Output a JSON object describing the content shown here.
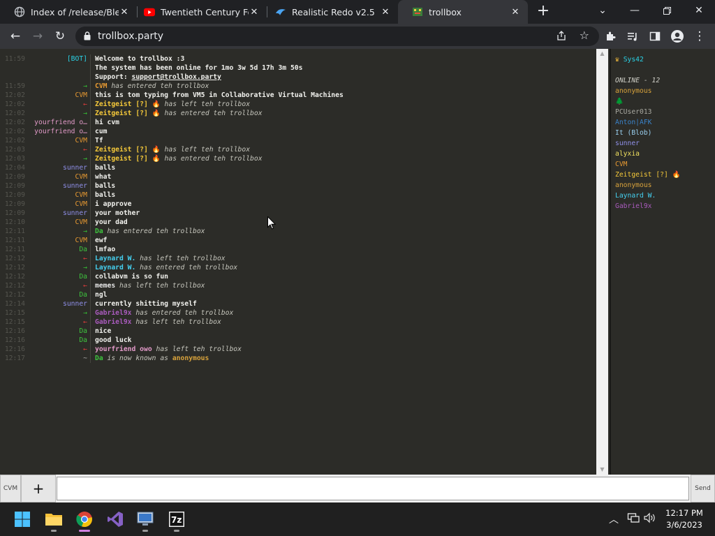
{
  "browser": {
    "tabs": [
      {
        "title": "Index of /release/Blend",
        "favicon": "globe-icon",
        "active": false
      },
      {
        "title": "Twentieth Century Fox",
        "favicon": "youtube-icon",
        "active": false
      },
      {
        "title": "Realistic Redo v2.5",
        "favicon": "bird-icon",
        "active": false
      },
      {
        "title": "trollbox",
        "favicon": "trollbox-icon",
        "active": true
      }
    ],
    "url": "trollbox.party"
  },
  "colors": {
    "bot": "#2ad2e6",
    "system": "#27c627",
    "cvm": "#e89a32",
    "zeitgeist": "#f5c93a",
    "yourfriend": "#e29ac8",
    "sunner": "#8f8fe8",
    "da": "#3ec43e",
    "laynard": "#45d0f0",
    "gabriel": "#a95bbd",
    "memes": "#e7e7e7",
    "left_arrow": "#e23c3c",
    "enter_arrow": "#34c234",
    "nick_arrow": "#aaaaaa",
    "anonymous": "#d9a33c"
  },
  "messages": [
    {
      "time": "11:59",
      "nick": "[BOT]",
      "nick_color": "#2ad2e6",
      "text": "Welcome to trollbox :3"
    },
    {
      "time": "",
      "nick": "",
      "nick_color": "#2ad2e6",
      "text": "The system has been online for 1mo 3w 5d 17h 3m 50s"
    },
    {
      "time": "",
      "nick": "",
      "nick_color": "#2ad2e6",
      "text": "Support: ",
      "link": "support@trollbox.party"
    },
    {
      "time": "11:59",
      "nick": "→",
      "nick_color": "#34c234",
      "who": "CVM",
      "who_color": "#e89a32",
      "action": " has entered teh trollbox"
    },
    {
      "time": "12:02",
      "nick": "CVM",
      "nick_color": "#e89a32",
      "text": "this is tom typing from VM5 in Collaborative Virtual Machines"
    },
    {
      "time": "12:02",
      "nick": "←",
      "nick_color": "#e23c3c",
      "who": "Zeitgeist [?] 🔥",
      "who_color": "#f5c93a",
      "action": " has left teh trollbox"
    },
    {
      "time": "12:02",
      "nick": "→",
      "nick_color": "#34c234",
      "who": "Zeitgeist [?] 🔥",
      "who_color": "#f5c93a",
      "action": " has entered teh trollbox"
    },
    {
      "time": "12:02",
      "nick": "yourfriend o…",
      "nick_color": "#e29ac8",
      "text": "hi cvm"
    },
    {
      "time": "12:02",
      "nick": "yourfriend o…",
      "nick_color": "#e29ac8",
      "text": "cum"
    },
    {
      "time": "12:02",
      "nick": "CVM",
      "nick_color": "#e89a32",
      "text": "Tf"
    },
    {
      "time": "12:03",
      "nick": "←",
      "nick_color": "#e23c3c",
      "who": "Zeitgeist [?] 🔥",
      "who_color": "#f5c93a",
      "action": " has left teh trollbox"
    },
    {
      "time": "12:03",
      "nick": "→",
      "nick_color": "#34c234",
      "who": "Zeitgeist [?] 🔥",
      "who_color": "#f5c93a",
      "action": " has entered teh trollbox"
    },
    {
      "time": "12:04",
      "nick": "sunner",
      "nick_color": "#8f8fe8",
      "text": "balls"
    },
    {
      "time": "12:09",
      "nick": "CVM",
      "nick_color": "#e89a32",
      "text": "what"
    },
    {
      "time": "12:09",
      "nick": "sunner",
      "nick_color": "#8f8fe8",
      "text": "balls"
    },
    {
      "time": "12:09",
      "nick": "CVM",
      "nick_color": "#e89a32",
      "text": "balls"
    },
    {
      "time": "12:09",
      "nick": "CVM",
      "nick_color": "#e89a32",
      "text": "i approve"
    },
    {
      "time": "12:09",
      "nick": "sunner",
      "nick_color": "#8f8fe8",
      "text": "your mother"
    },
    {
      "time": "12:10",
      "nick": "CVM",
      "nick_color": "#e89a32",
      "text": "your dad"
    },
    {
      "time": "12:11",
      "nick": "→",
      "nick_color": "#34c234",
      "who": "Da",
      "who_color": "#3ec43e",
      "action": " has entered teh trollbox"
    },
    {
      "time": "12:11",
      "nick": "CVM",
      "nick_color": "#e89a32",
      "text": "ewf"
    },
    {
      "time": "12:11",
      "nick": "Da",
      "nick_color": "#3ec43e",
      "text": "lmfao"
    },
    {
      "time": "12:12",
      "nick": "←",
      "nick_color": "#e23c3c",
      "who": "Laynard W.",
      "who_color": "#45d0f0",
      "action": " has left teh trollbox"
    },
    {
      "time": "12:12",
      "nick": "→",
      "nick_color": "#34c234",
      "who": "Laynard W.",
      "who_color": "#45d0f0",
      "action": " has entered teh trollbox"
    },
    {
      "time": "12:12",
      "nick": "Da",
      "nick_color": "#3ec43e",
      "text": "collabvm is so fun"
    },
    {
      "time": "12:12",
      "nick": "←",
      "nick_color": "#e23c3c",
      "who": "memes",
      "who_color": "#e7e7e7",
      "action": " has left teh trollbox"
    },
    {
      "time": "12:12",
      "nick": "Da",
      "nick_color": "#3ec43e",
      "text": "ngl"
    },
    {
      "time": "12:14",
      "nick": "sunner",
      "nick_color": "#8f8fe8",
      "text": "currently shitting myself"
    },
    {
      "time": "12:15",
      "nick": "→",
      "nick_color": "#34c234",
      "who": "Gabriel9x",
      "who_color": "#a95bbd",
      "action": " has entered teh trollbox"
    },
    {
      "time": "12:15",
      "nick": "←",
      "nick_color": "#e23c3c",
      "who": "Gabriel9x",
      "who_color": "#a95bbd",
      "action": " has left teh trollbox"
    },
    {
      "time": "12:16",
      "nick": "Da",
      "nick_color": "#3ec43e",
      "text": "nice"
    },
    {
      "time": "12:16",
      "nick": "Da",
      "nick_color": "#3ec43e",
      "text": "good luck"
    },
    {
      "time": "12:16",
      "nick": "←",
      "nick_color": "#e23c3c",
      "who": "yourfriend owo",
      "who_color": "#e29ac8",
      "action": " has left teh trollbox"
    },
    {
      "time": "12:17",
      "nick": "~",
      "nick_color": "#aaaaaa",
      "who": "Da",
      "who_color": "#3ec43e",
      "action": " is now known as ",
      "target": "anonymous",
      "target_color": "#d9a33c"
    }
  ],
  "userlist": {
    "top_user": {
      "name": "Sys42",
      "color": "#2ad2e6",
      "icon": "crown-icon"
    },
    "online_label": "ONLINE - 12",
    "users": [
      {
        "name": "anonymous",
        "color": "#d9a33c"
      },
      {
        "name": "🌲",
        "color": "#3ec43e"
      },
      {
        "name": "PCUser013",
        "color": "#a8a8a0"
      },
      {
        "name": "Anton|AFK",
        "color": "#3a82c8"
      },
      {
        "name": "It (Blob)",
        "color": "#9ad0f0"
      },
      {
        "name": "sunner",
        "color": "#8f8fe8"
      },
      {
        "name": "alyxia",
        "color": "#f0e060"
      },
      {
        "name": "CVM",
        "color": "#e89a32"
      },
      {
        "name": "Zeitgeist [?] 🔥",
        "color": "#f5c93a"
      },
      {
        "name": "anonymous",
        "color": "#d9a33c"
      },
      {
        "name": "Laynard W.",
        "color": "#45d0f0"
      },
      {
        "name": "Gabriel9x",
        "color": "#a95bbd"
      }
    ]
  },
  "input": {
    "nick_button": "CVM",
    "add_button": "+",
    "value": "",
    "send_label": "Send"
  },
  "taskbar": {
    "time": "12:17 PM",
    "date": "3/6/2023"
  }
}
